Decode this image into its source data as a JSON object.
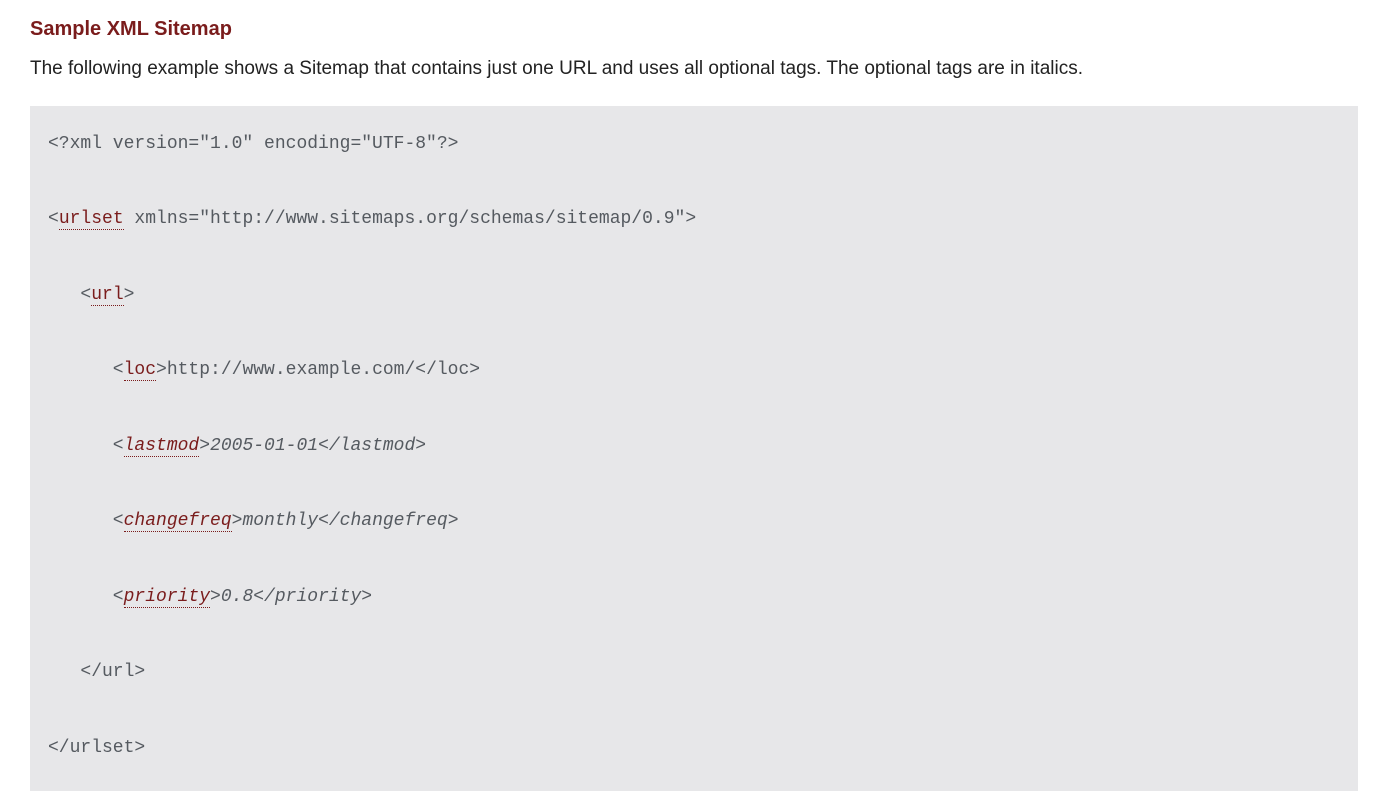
{
  "heading": "Sample XML Sitemap",
  "intro": "The following example shows a Sitemap that contains just one URL and uses all optional tags. The optional tags are in italics.",
  "code": {
    "line1": "<?xml version=\"1.0\" encoding=\"UTF-8\"?>",
    "line2_pre": "<",
    "line2_tag": "urlset",
    "line2_post": " xmlns=\"http://www.sitemaps.org/schemas/sitemap/0.9\">",
    "line3_pre": "   <",
    "line3_tag": "url",
    "line3_post": ">",
    "line4_pre": "      <",
    "line4_tag": "loc",
    "line4_post": ">http://www.example.com/</loc>",
    "line5_pre": "      <",
    "line5_tag": "lastmod",
    "line5_post": ">2005-01-01</lastmod>",
    "line6_pre": "      <",
    "line6_tag": "changefreq",
    "line6_post": ">monthly</changefreq>",
    "line7_pre": "      <",
    "line7_tag": "priority",
    "line7_post": ">0.8</priority>",
    "line8": "   </url>",
    "line9": "</urlset> "
  }
}
